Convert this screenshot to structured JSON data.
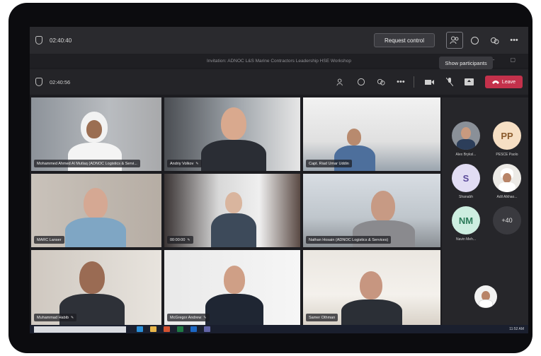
{
  "outer_bar": {
    "timer": "02:40:40",
    "request_control_label": "Request control"
  },
  "tooltip": "Show participants",
  "title_bar": {
    "meeting_title": "Invitation: ADNOC L&S Marine Contractors Leadership HSE Workshop"
  },
  "inner_bar": {
    "timer": "02:40:56",
    "leave_label": "Leave"
  },
  "tiles": [
    {
      "name": "Mohammed Ahmed Al Mutlaq (ADNOC Logistics & Servi..."
    },
    {
      "name": "Andriy Volkov"
    },
    {
      "name": "Capt. Riad Umar Uddin"
    },
    {
      "name": "MARC Lanser"
    },
    {
      "name": "00:00:00"
    },
    {
      "name": "Nathan Hosain (ADNOC Logistics & Services)"
    },
    {
      "name": "Muhammad Habib"
    },
    {
      "name": "McGregor Andrew"
    },
    {
      "name": "Samer Othman"
    }
  ],
  "participants": [
    {
      "initials": "",
      "name": "Alex Bryksl..."
    },
    {
      "initials": "PP",
      "name": "PESCE Paolo"
    },
    {
      "initials": "S",
      "name": "Shanabh"
    },
    {
      "initials": "",
      "name": "Adil Alkhao..."
    },
    {
      "initials": "NM",
      "name": "Navin Meh..."
    },
    {
      "initials": "+40",
      "name": ""
    }
  ],
  "taskbar": {
    "clock": "11:52 AM"
  },
  "colors": {
    "leave": "#c4314b",
    "accent": "#7b83eb"
  },
  "icons": [
    "shield-icon",
    "participants-icon",
    "chat-icon",
    "reactions-icon",
    "more-icon",
    "camera-icon",
    "mic-off-icon",
    "share-icon",
    "phone-icon"
  ]
}
